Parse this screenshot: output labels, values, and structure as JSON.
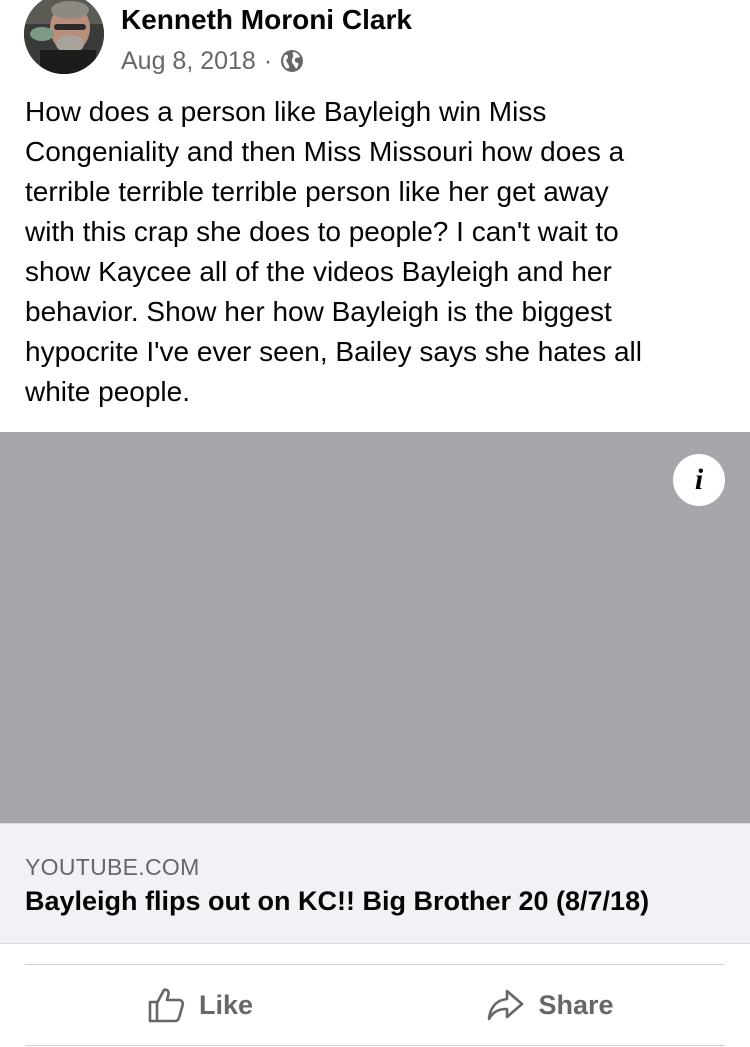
{
  "post": {
    "author": "Kenneth Moroni Clark",
    "date": "Aug 8, 2018",
    "separator": "·",
    "privacy_icon": "globe-icon",
    "text_lines": [
      "How does a person like Bayleigh win Miss",
      "Congeniality and then Miss Missouri how does a",
      "terrible terrible terrible person like her get away",
      "with this crap she does to people? I can't wait to",
      "show Kaycee all of the videos Bayleigh and her",
      "behavior. Show her how Bayleigh is the biggest",
      "hypocrite I've ever seen, Bailey says she hates all",
      "white people."
    ]
  },
  "link_preview": {
    "info_icon": "info-icon",
    "info_glyph": "i",
    "domain": "YOUTUBE.COM",
    "title": "Bayleigh flips out on KC!! Big Brother 20 (8/7/18)"
  },
  "actions": {
    "like_label": "Like",
    "like_icon": "thumbs-up-icon",
    "share_label": "Share",
    "share_icon": "share-arrow-icon"
  },
  "colors": {
    "media_placeholder": "#a6a7ab",
    "secondary_text": "#65676b",
    "card_background": "#f0f2f5"
  }
}
